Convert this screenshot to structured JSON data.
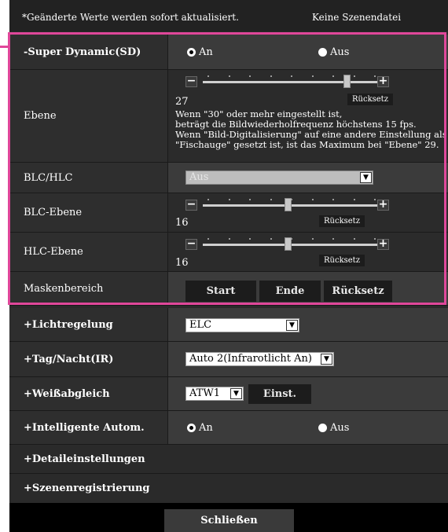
{
  "header": {
    "note": "*Geänderte Werte werden sofort aktualisiert.",
    "scene": "Keine Szenendatei"
  },
  "super_dynamic": {
    "label": "-Super Dynamic(SD)",
    "on_label": "An",
    "off_label": "Aus",
    "selected": "An"
  },
  "ebene": {
    "label": "Ebene",
    "value": "27",
    "level": 27,
    "max": 32,
    "reset": "Rücksetz",
    "desc": [
      "Wenn \"30\" oder mehr eingestellt ist,",
      "beträgt die Bildwiederholfrequenz höchstens 15 fps.",
      "Wenn \"Bild-Digitalisierung\" auf eine andere Einstellung als",
      "\"Fischauge\" gesetzt ist, ist das Maximum bei \"Ebene\" 29."
    ]
  },
  "blc_hlc": {
    "label": "BLC/HLC",
    "value": "Aus"
  },
  "blc_level": {
    "label": "BLC-Ebene",
    "value": "16",
    "level": 16,
    "max": 32,
    "reset": "Rücksetz"
  },
  "hlc_level": {
    "label": "HLC-Ebene",
    "value": "16",
    "level": 16,
    "max": 32,
    "reset": "Rücksetz"
  },
  "mask": {
    "label": "Maskenbereich",
    "start": "Start",
    "end": "Ende",
    "reset": "Rücksetz"
  },
  "light": {
    "label": "+Lichtregelung",
    "value": "ELC"
  },
  "daynight": {
    "label": "+Tag/Nacht(IR)",
    "value": "Auto 2(Infrarotlicht An)"
  },
  "whitebalance": {
    "label": "+Weißabgleich",
    "value": "ATW1",
    "set": "Einst."
  },
  "intelligent": {
    "label": "+Intelligente Autom.",
    "on_label": "An",
    "off_label": "Aus",
    "selected": "An"
  },
  "detail": {
    "label": "+Detaileinstellungen"
  },
  "scene_reg": {
    "label": "+Szenenregistrierung"
  },
  "footer": {
    "close": "Schließen"
  },
  "colors": {
    "highlight": "#e0479a"
  }
}
